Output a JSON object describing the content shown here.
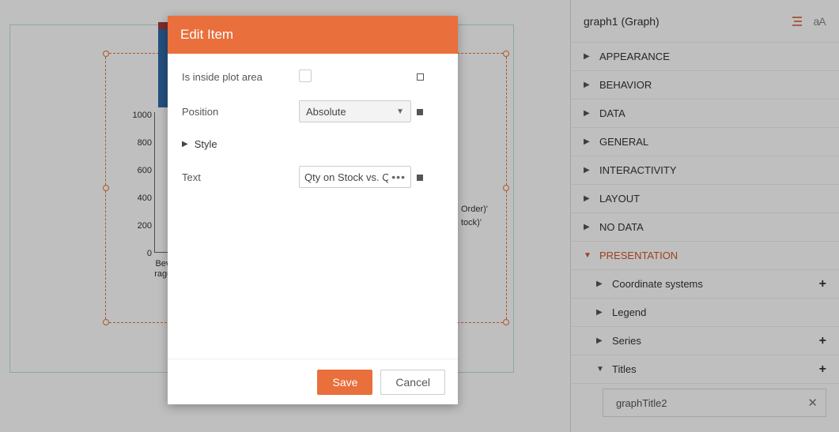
{
  "modal": {
    "title": "Edit Item",
    "fields": {
      "inside_label": "Is inside plot area",
      "position_label": "Position",
      "position_value": "Absolute",
      "style_label": "Style",
      "text_label": "Text",
      "text_value": "Qty on Stock vs. Qty"
    },
    "buttons": {
      "save": "Save",
      "cancel": "Cancel"
    }
  },
  "right_panel": {
    "title": "graph1 (Graph)",
    "sections": {
      "appearance": "APPEARANCE",
      "behavior": "BEHAVIOR",
      "data": "DATA",
      "general": "GENERAL",
      "interactivity": "INTERACTIVITY",
      "layout": "LAYOUT",
      "nodata": "NO DATA",
      "presentation": "PRESENTATION",
      "coord": "Coordinate systems",
      "legend": "Legend",
      "series": "Series",
      "titles": "Titles"
    },
    "title_item": "graphTitle2"
  },
  "chart_data": {
    "type": "bar",
    "stacked": true,
    "categories": [
      "Beverages"
    ],
    "series": [
      {
        "name": "'Sum(Qty on Stock)'",
        "values": [
          560
        ]
      },
      {
        "name": "'Sum(Qty on Order)'",
        "values": [
          50
        ]
      }
    ],
    "ylim": [
      0,
      1000
    ],
    "yticks": [
      0,
      200,
      400,
      600,
      800,
      1000
    ],
    "category_label_display": "Beverages",
    "legend_visible_lines": [
      "Order)'",
      "tock)'"
    ]
  }
}
